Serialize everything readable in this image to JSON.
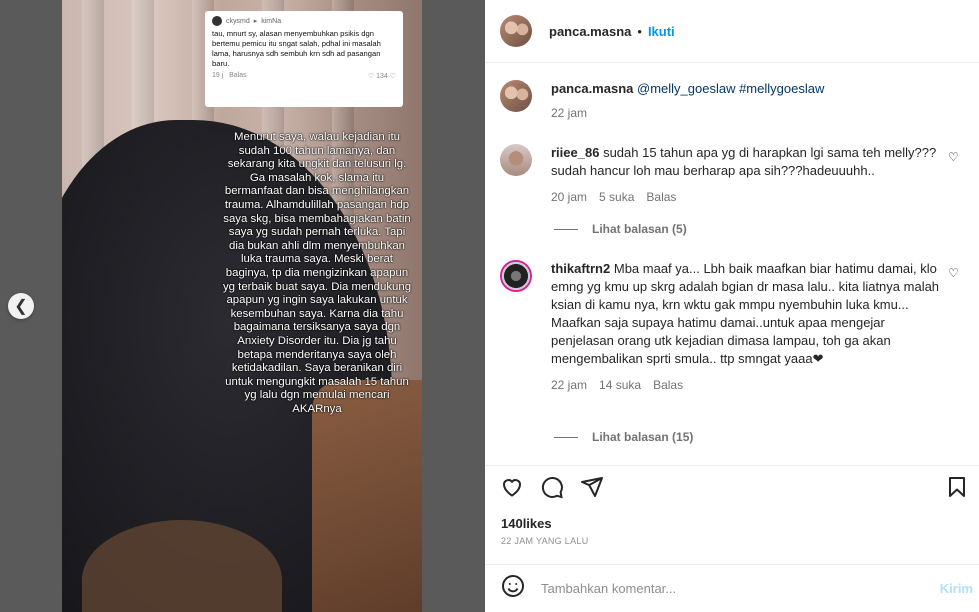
{
  "media": {
    "comment_card": {
      "user": "ckysmd",
      "arrow": "▸",
      "reply_to": "kimNa",
      "text": "tau, mnurt sy, alasan menyembuhkan psikis dgn bertemu pemicu itu sngat salah, pdhal ini masalah lama, harusnya sdh sembuh krn sdh ad pasangan baru.",
      "age": "19 j",
      "reply_label": "Balas",
      "likes": "134"
    },
    "overlay_text": "Menurut saya, walau kejadian itu sudah 100 tahun lamanya, dan sekarang kita ungkit dan telusuri lg. Ga masalah kok, slama itu bermanfaat dan bisa menghilangkan trauma. Alhamdulillah pasangan hdp saya skg, bisa membahagiakan batin saya yg sudah pernah terluka. Tapi dia bukan ahli dlm menyembuhkan luka trauma saya. Meski berat baginya, tp dia mengizinkan apapun yg terbaik buat saya. Dia mendukung apapun yg ingin saya lakukan untuk kesembuhan saya. Karna dia tahu bagaimana tersiksanya saya dgn Anxiety Disorder itu. Dia jg tahu betapa menderitanya saya oleh ketidakadilan. Saya beranikan diri untuk mengungkit masalah 15 tahun yg lalu dgn memulai mencari AKARnya"
  },
  "header": {
    "username": "panca.masna",
    "separator": "•",
    "follow_label": "Ikuti"
  },
  "caption": {
    "username": "panca.masna",
    "text": "@melly_goeslaw #mellygoeslaw",
    "time": "22 jam"
  },
  "comments": [
    {
      "username": "riiee_86",
      "text": "sudah 15 tahun apa yg di harapkan lgi sama teh melly???sudah hancur loh mau berharap apa sih???hadeuuuhh..",
      "time": "20 jam",
      "likes": "5 suka",
      "reply": "Balas",
      "view_replies": "Lihat balasan (5)"
    },
    {
      "username": "thikaftrn2",
      "text": "Mba maaf ya... Lbh baik maafkan biar hatimu damai, klo emng yg kmu up skrg adalah bgian dr masa lalu.. kita liatnya malah ksian di kamu nya, krn wktu gak mmpu nyembuhin luka kmu... Maafkan saja supaya hatimu damai..untuk apaa mengejar penjelasan orang utk kejadian dimasa lampau, toh ga akan mengembalikan sprti smula.. ttp smngat yaaa❤",
      "time": "22 jam",
      "likes": "14 suka",
      "reply": "Balas",
      "view_replies": "Lihat balasan (15)"
    }
  ],
  "actions": {
    "likes": "140likes",
    "posted": "22 JAM YANG LALU"
  },
  "add_comment": {
    "placeholder": "Tambahkan komentar...",
    "post_label": "Kirim"
  },
  "icons": {
    "prev": "chevron-left-icon",
    "like": "heart-icon",
    "comment": "comment-icon",
    "share": "paper-plane-icon",
    "save": "bookmark-icon",
    "emoji": "emoji-icon"
  },
  "colors": {
    "accent": "#0095f6",
    "post_disabled": "#b2dffc",
    "text": "#262626",
    "muted": "#737373"
  }
}
